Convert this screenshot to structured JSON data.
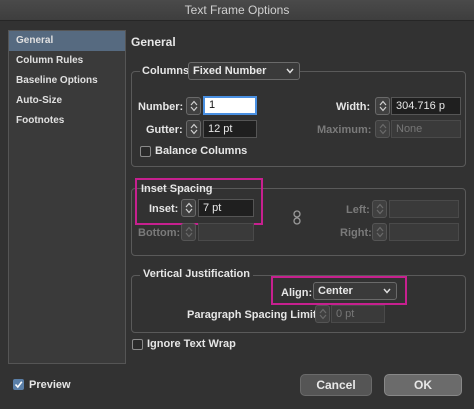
{
  "window": {
    "title": "Text Frame Options"
  },
  "sidebar": {
    "items": [
      {
        "label": "General"
      },
      {
        "label": "Column Rules"
      },
      {
        "label": "Baseline Options"
      },
      {
        "label": "Auto-Size"
      },
      {
        "label": "Footnotes"
      }
    ],
    "selected": "General"
  },
  "section": {
    "title": "General"
  },
  "columns": {
    "label": "Columns:",
    "type_value": "Fixed Number",
    "number_label": "Number:",
    "number_value": "1",
    "gutter_label": "Gutter:",
    "gutter_value": "12 pt",
    "width_label": "Width:",
    "width_value": "304.716 p",
    "maximum_label": "Maximum:",
    "maximum_value": "None",
    "balance_label": "Balance Columns",
    "balance_checked": false
  },
  "inset": {
    "title": "Inset Spacing",
    "inset_label": "Inset:",
    "inset_value": "7 pt",
    "bottom_label": "Bottom:",
    "left_label": "Left:",
    "right_label": "Right:"
  },
  "vertical": {
    "title": "Vertical Justification",
    "align_label": "Align:",
    "align_value": "Center",
    "para_label": "Paragraph Spacing Limit:",
    "para_value": "0 pt"
  },
  "ignore_wrap": {
    "label": "Ignore Text Wrap",
    "checked": false
  },
  "preview": {
    "label": "Preview",
    "checked": true
  },
  "buttons": {
    "cancel": "Cancel",
    "ok": "OK"
  },
  "colors": {
    "highlight": "#c7208f",
    "selected_item": "#566a80",
    "focus": "#4a90e2"
  }
}
